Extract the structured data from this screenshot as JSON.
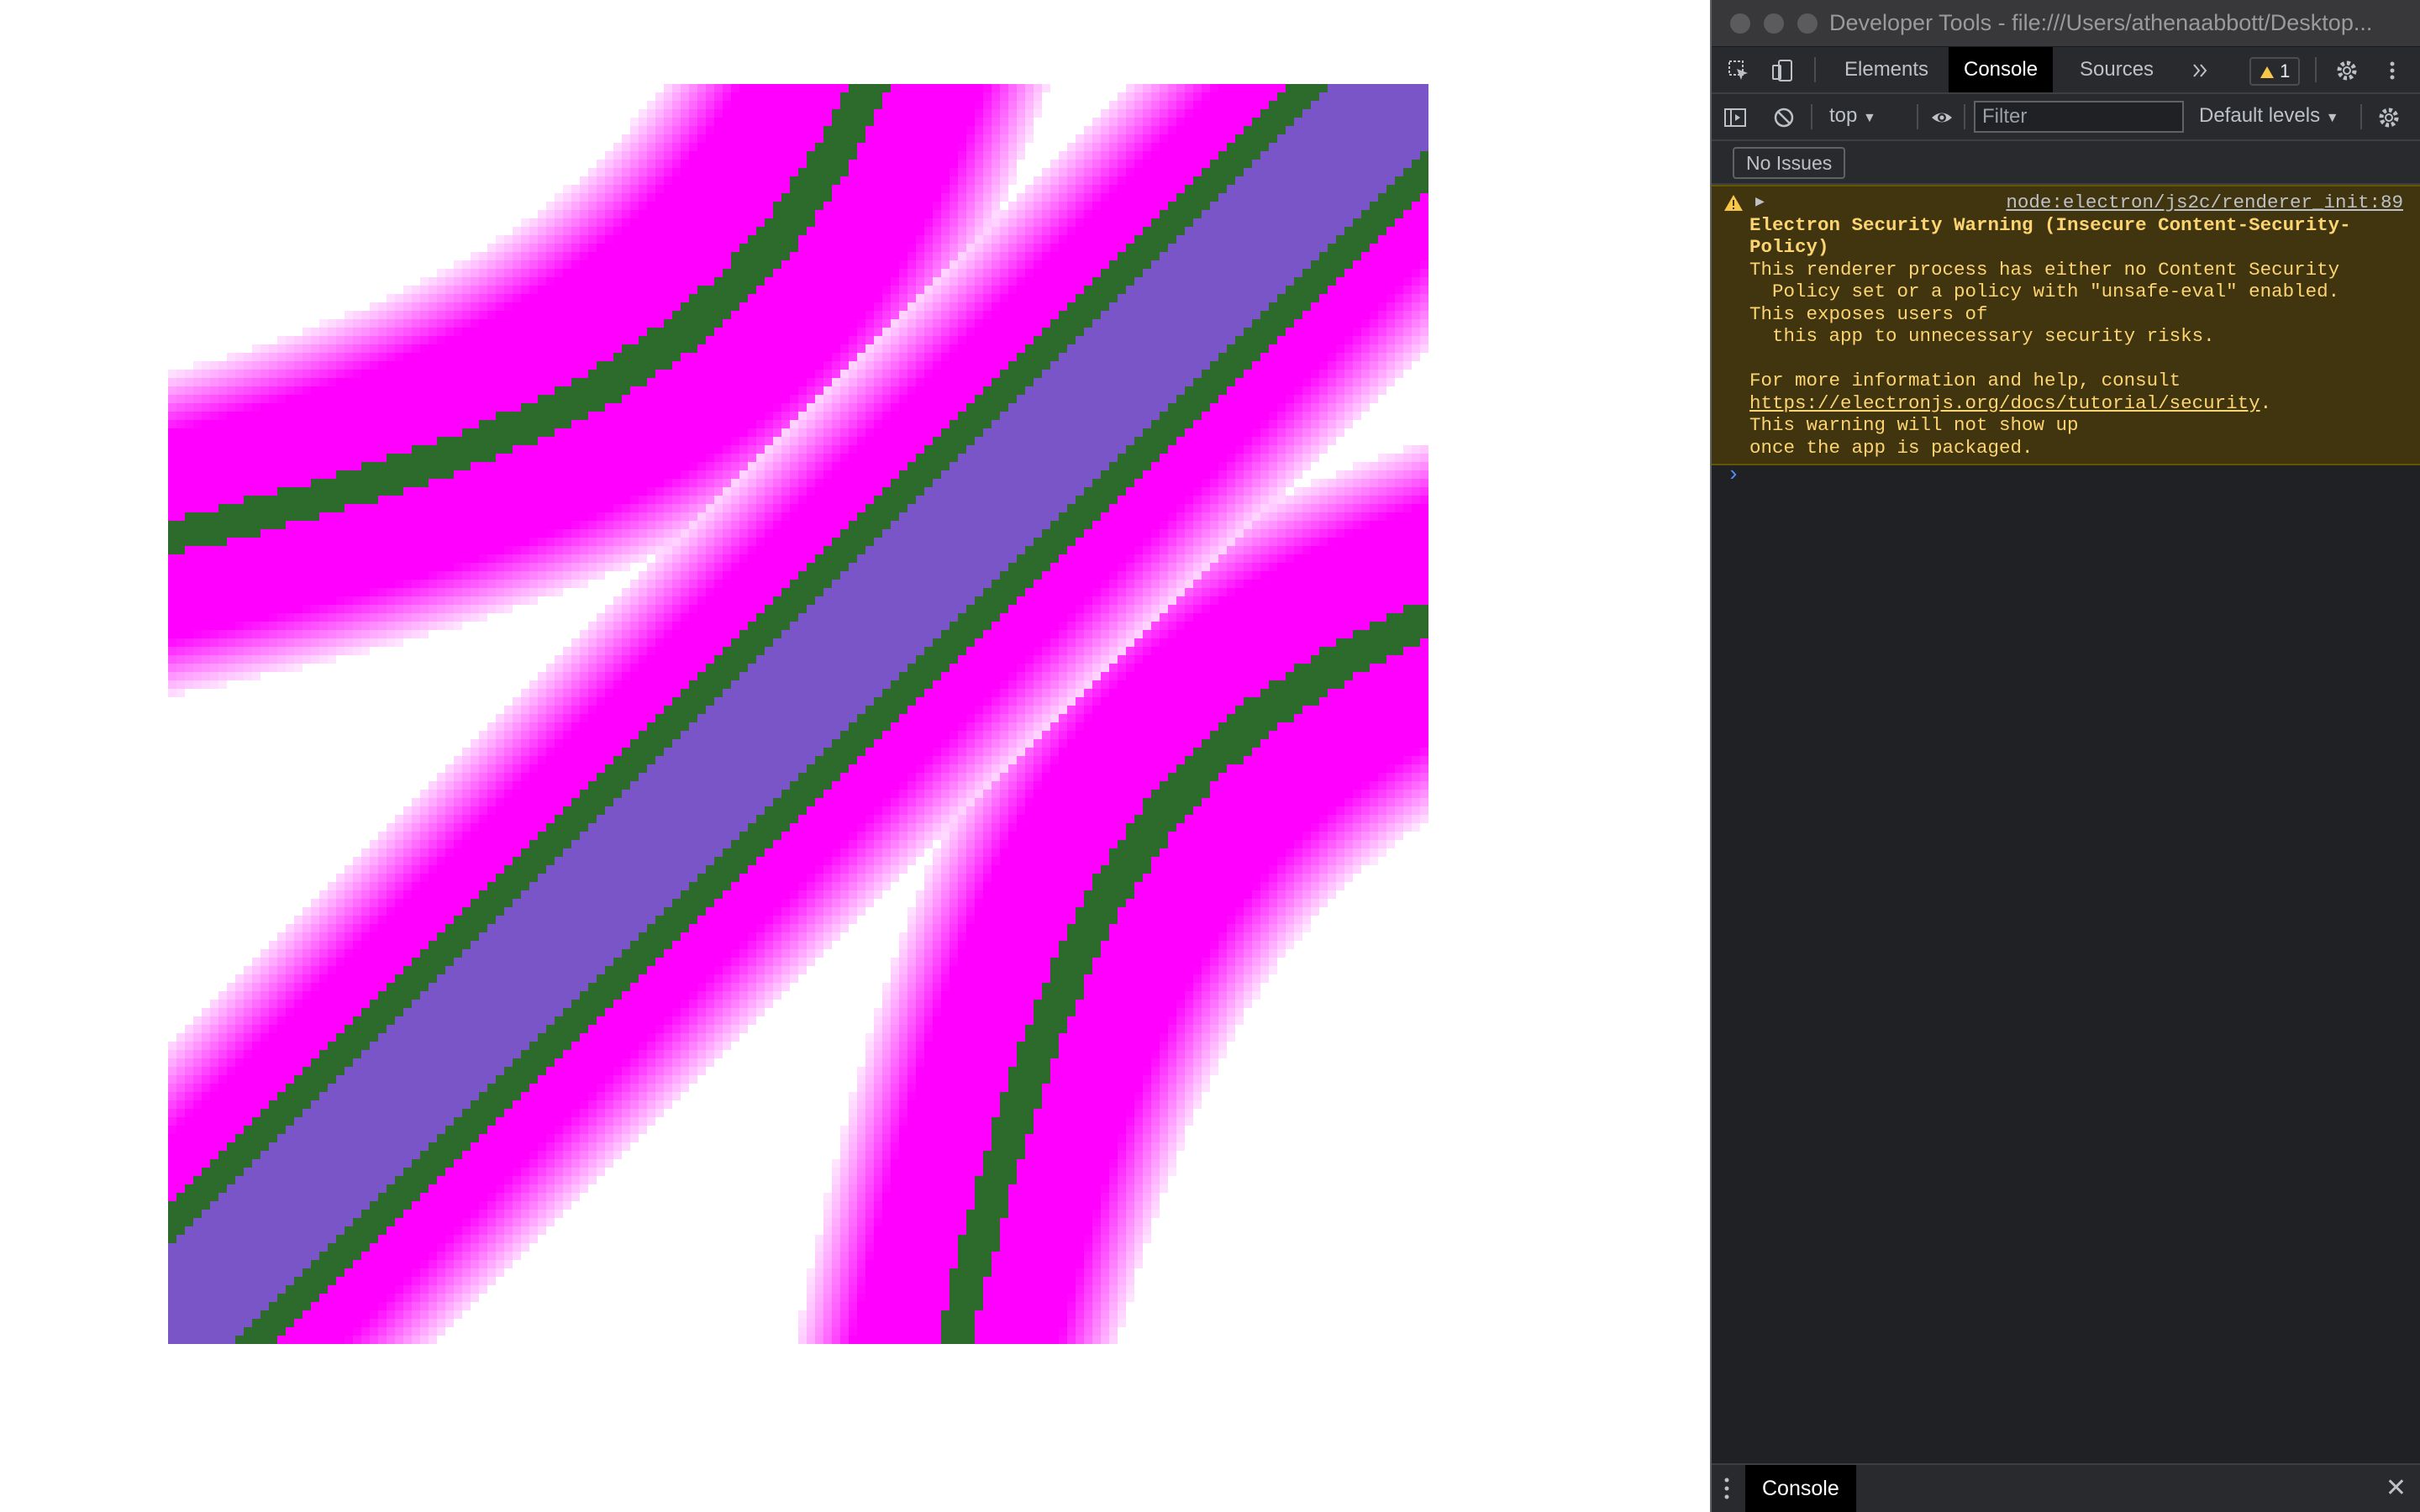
{
  "window": {
    "title": "Developer Tools - file:///Users/athenaabbott/Desktop..."
  },
  "tabs": [
    {
      "label": "Elements"
    },
    {
      "label": "Console"
    },
    {
      "label": "Sources"
    }
  ],
  "warnings_badge": "1",
  "toolbar": {
    "context": "top",
    "filter_placeholder": "Filter",
    "levels": "Default levels"
  },
  "issues": {
    "label": "No Issues"
  },
  "console": {
    "message": {
      "source": "node:electron/js2c/renderer_init:89",
      "heading_1": "Electron Security Warning (Insecure Content-Security-",
      "heading_2": "Policy)",
      "line_1": "This renderer process has either no Content Security",
      "line_2": "  Policy set or a policy with \"unsafe-eval\" enabled.",
      "line_3": "This exposes users of",
      "line_4": "  this app to unnecessary security risks.",
      "line_5": "For more information and help, consult",
      "link": "https://electronjs.org/docs/tutorial/security",
      "link_suffix": ".",
      "line_6": "This warning will not show up",
      "line_7": "once the app is packaged."
    },
    "prompt": "›"
  },
  "drawer": {
    "tab": "Console",
    "close": "✕"
  },
  "colors": {
    "magenta": "#ff00ff",
    "green": "#2d6b2d",
    "purple": "#7a55c8",
    "devtools_bg": "#202124",
    "warning_bg": "#413510",
    "warning_text": "#fcd471"
  },
  "icons": [
    "inspect-icon",
    "device-toolbar-icon",
    "chevron-more-icon",
    "warning-icon",
    "settings-icon",
    "kebab-menu-icon",
    "sidebar-toggle-icon",
    "clear-console-icon",
    "eye-icon",
    "console-settings-icon"
  ]
}
